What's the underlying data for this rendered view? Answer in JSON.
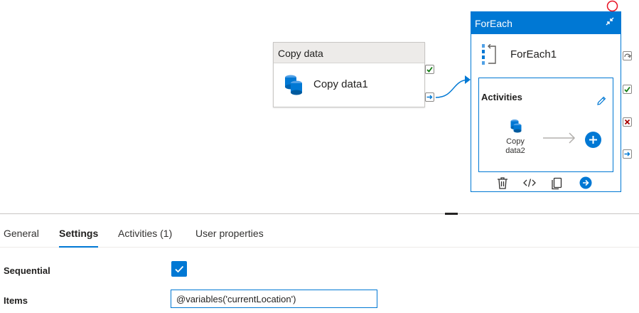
{
  "pipeline": {
    "copy_node": {
      "header": "Copy data",
      "name": "Copy data1",
      "icon": "copy-data-icon"
    },
    "foreach_node": {
      "header": "ForEach",
      "name": "ForEach1",
      "icon": "foreach-icon",
      "activities_title": "Activities",
      "inner_activity_label": "Copy data2",
      "actions": [
        "delete-icon",
        "code-icon",
        "clone-icon",
        "run-icon"
      ]
    },
    "colors": {
      "accent": "#0078d4",
      "success": "#107c10",
      "failure": "#a80000",
      "error_circle": "#e81123"
    }
  },
  "tabs": [
    {
      "label": "General",
      "active": false
    },
    {
      "label": "Settings",
      "active": true
    },
    {
      "label": "Activities (1)",
      "active": false
    },
    {
      "label": "User properties",
      "active": false
    }
  ],
  "settings": {
    "sequential_label": "Sequential",
    "sequential_checked": true,
    "items_label": "Items",
    "items_value": "@variables('currentLocation')"
  }
}
